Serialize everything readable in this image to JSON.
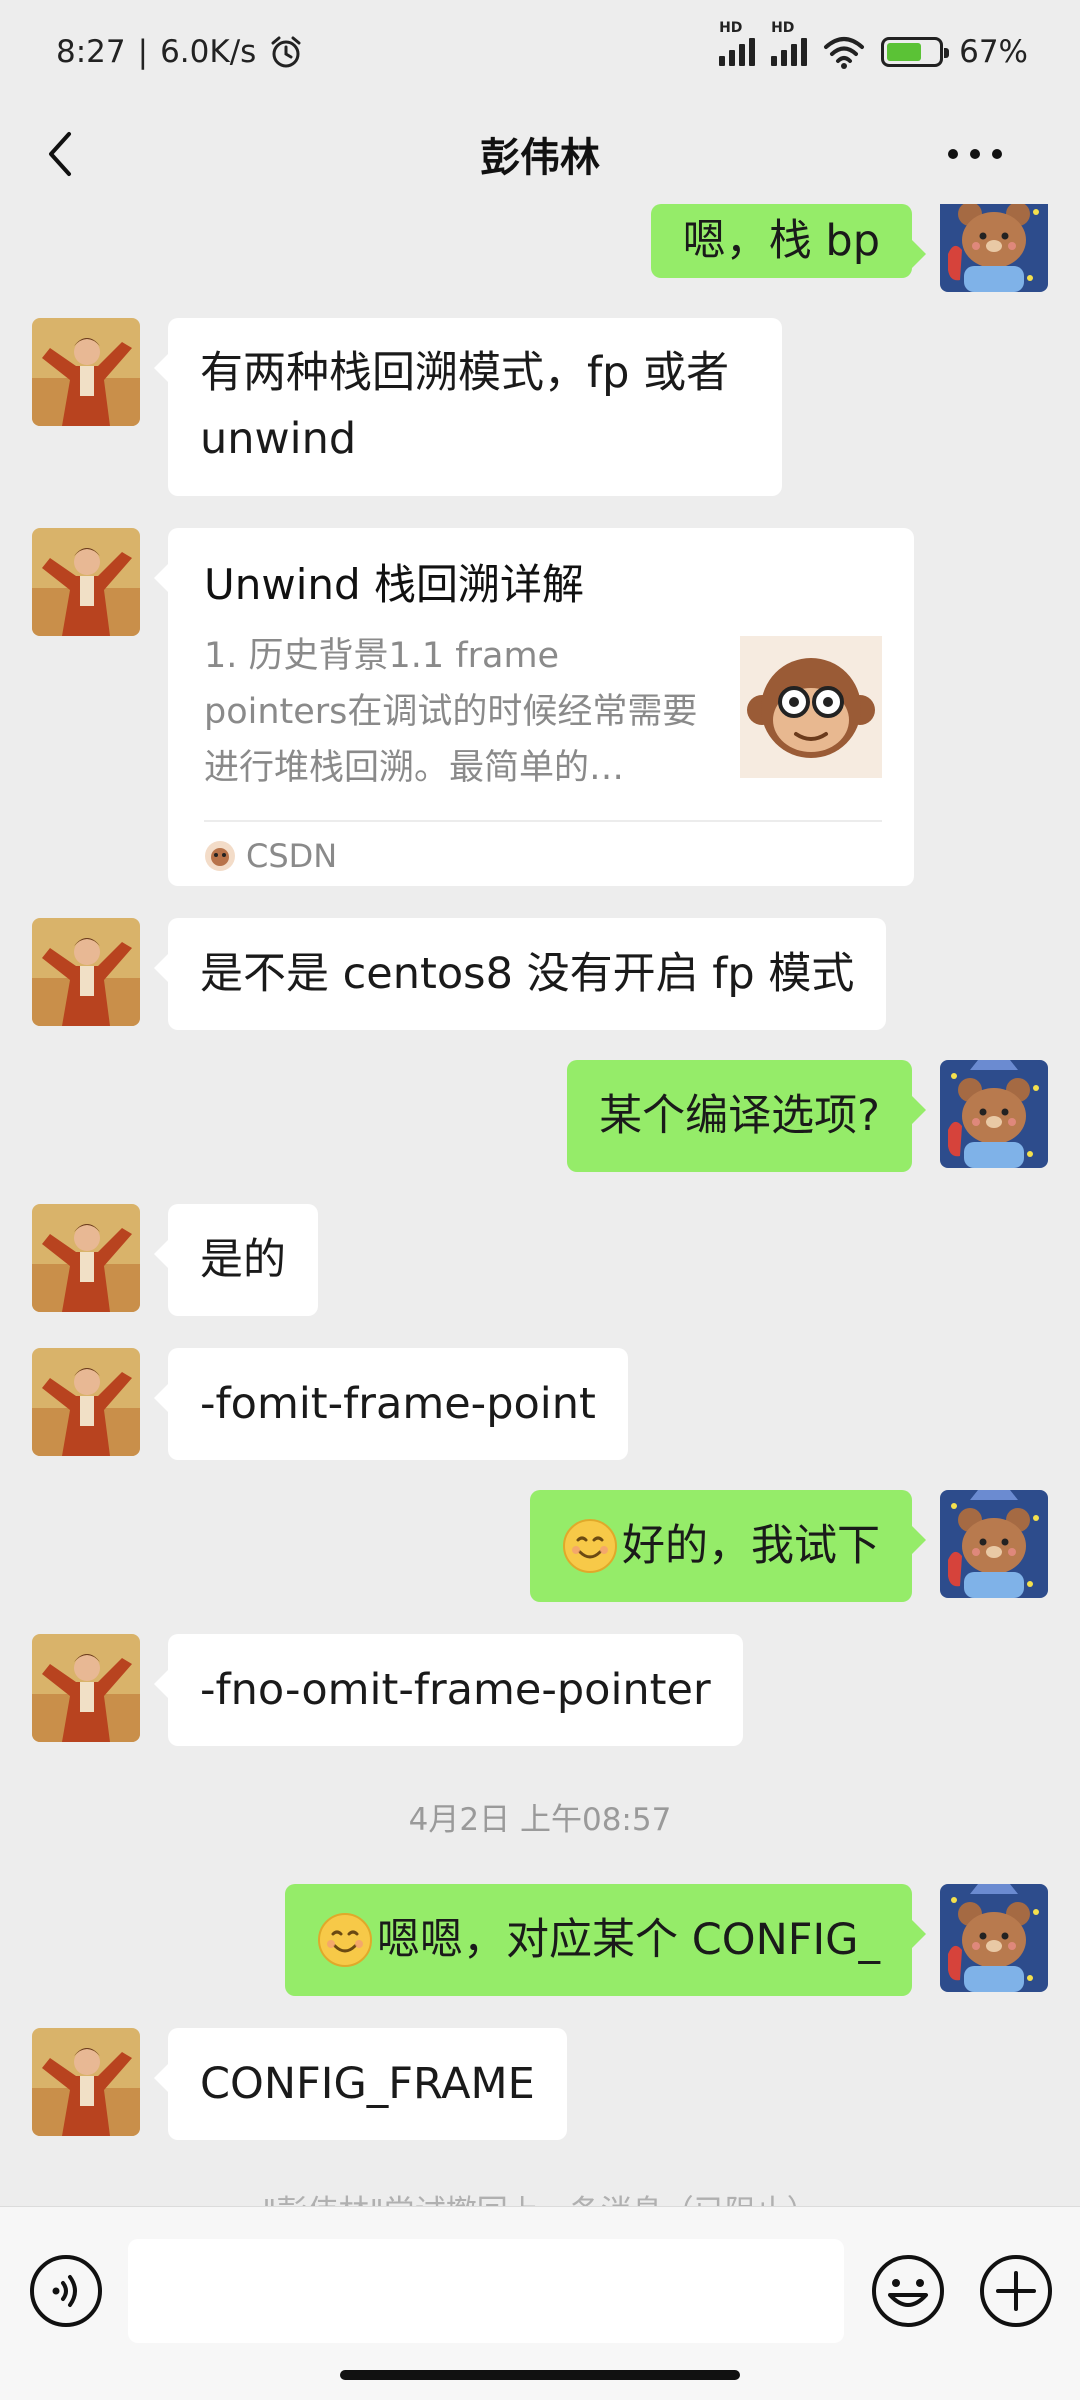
{
  "status_bar": {
    "time": "8:27",
    "net_speed": "6.0K/s",
    "sig1_label": "HD",
    "sig2_label": "HD",
    "battery": "67%",
    "battery_level": 0.67,
    "icons": [
      "alarm-icon",
      "signal-icon",
      "wifi-icon",
      "battery-icon"
    ]
  },
  "header": {
    "title": "彭伟林"
  },
  "messages": [
    {
      "side": "out",
      "text": "嗯，栈 bp"
    },
    {
      "side": "in",
      "text": "有两种栈回溯模式，fp 或者 unwind"
    },
    {
      "side": "in",
      "type": "link",
      "title": "Unwind 栈回溯详解",
      "desc": "1. 历史背景1.1 frame pointers在调试的时候经常需要进行堆栈回溯。最简单的…",
      "source": "CSDN"
    },
    {
      "side": "in",
      "text": "是不是 centos8 没有开启 fp 模式"
    },
    {
      "side": "out",
      "text": "某个编译选项?"
    },
    {
      "side": "in",
      "text": "是的"
    },
    {
      "side": "in",
      "text": "-fomit-frame-point"
    },
    {
      "side": "out",
      "emoji": "smile-emoji",
      "text": "好的，我试下"
    },
    {
      "side": "in",
      "text": "-fno-omit-frame-pointer"
    },
    {
      "side": "out",
      "emoji": "smile-emoji",
      "text": "嗯嗯，对应某个 CONFIG_"
    },
    {
      "side": "in",
      "text": "CONFIG_FRAME"
    }
  ],
  "timestamp": "4月2日 上午08:57",
  "system_note": "\"彭伟林\"尝试撤回上一条消息（已阻止）",
  "colors": {
    "background": "#ededed",
    "incoming_bubble": "#ffffff",
    "outgoing_bubble": "#95ec69",
    "input_bar": "#f7f7f7"
  }
}
